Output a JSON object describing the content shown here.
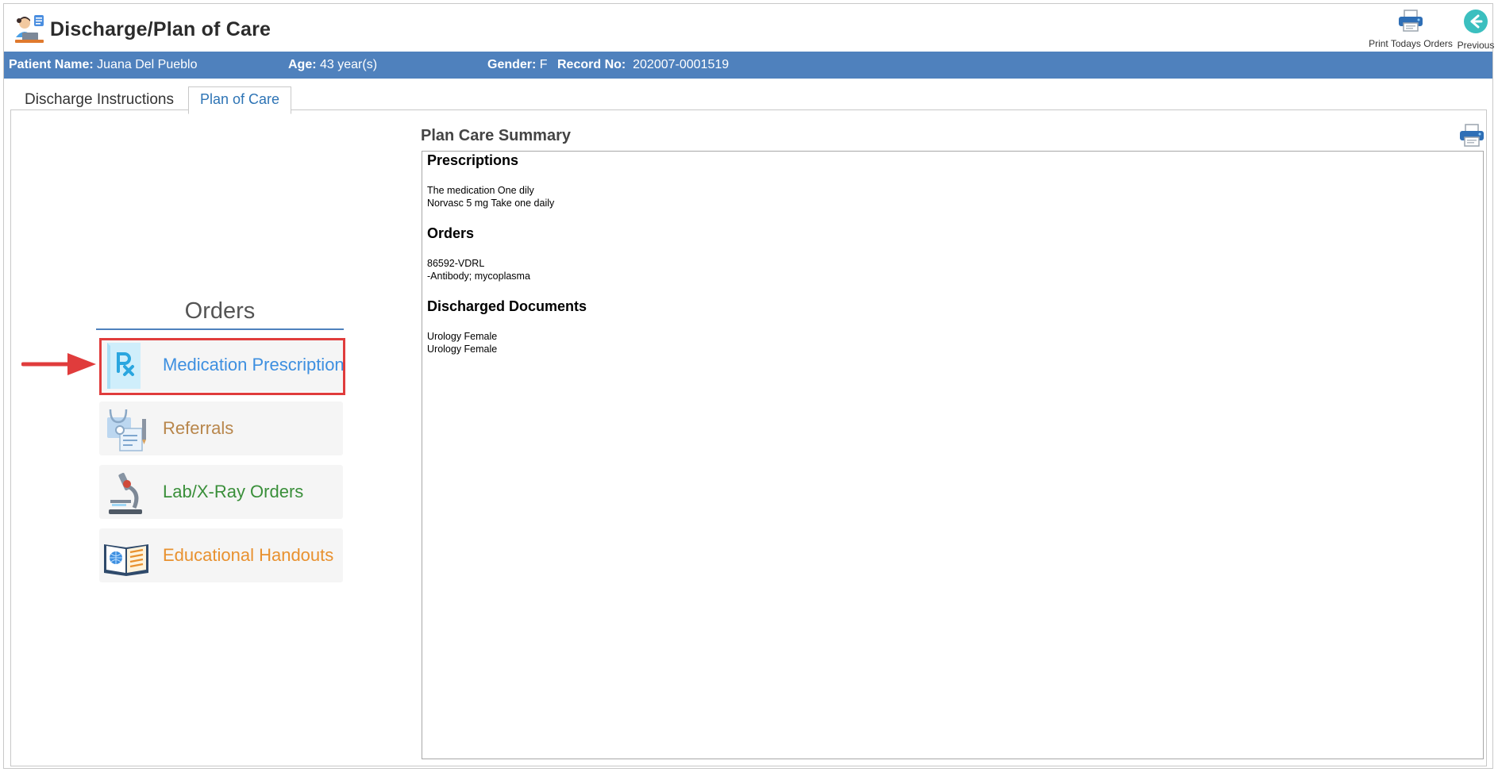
{
  "app": {
    "title": "Discharge/Plan of Care",
    "print_orders_label": "Print Todays Orders",
    "previous_label": "Previous"
  },
  "patient": {
    "name_label": "Patient Name:",
    "name": "Juana Del Pueblo",
    "age_label": "Age:",
    "age": "43 year(s)",
    "gender_label": "Gender:",
    "gender": "F",
    "record_label": "Record No:",
    "record": "202007-0001519"
  },
  "tabs": [
    {
      "label": "Discharge Instructions",
      "active": false
    },
    {
      "label": "Plan of Care",
      "active": true
    }
  ],
  "orders": {
    "title": "Orders",
    "items": [
      {
        "label": "Medication Prescription",
        "icon": "prescription-icon",
        "color": "#3d8fe0",
        "highlighted": true
      },
      {
        "label": "Referrals",
        "icon": "referral-icon",
        "color": "#b8864b"
      },
      {
        "label": "Lab/X-Ray Orders",
        "icon": "microscope-icon",
        "color": "#3a8f3a"
      },
      {
        "label": "Educational Handouts",
        "icon": "book-icon",
        "color": "#e8912f"
      }
    ]
  },
  "summary": {
    "title": "Plan Care Summary",
    "sections": [
      {
        "heading": "Prescriptions",
        "lines": [
          "The medication One dily",
          "Norvasc 5 mg Take one daily"
        ]
      },
      {
        "heading": "Orders",
        "lines": [
          "86592-VDRL",
          "-Antibody; mycoplasma"
        ]
      },
      {
        "heading": "Discharged Documents",
        "lines": [
          "Urology Female",
          "Urology Female"
        ]
      }
    ]
  },
  "colors": {
    "patient_bar": "#4f81bd",
    "highlight": "#e03c3c",
    "active_tab": "#2e74b5"
  }
}
